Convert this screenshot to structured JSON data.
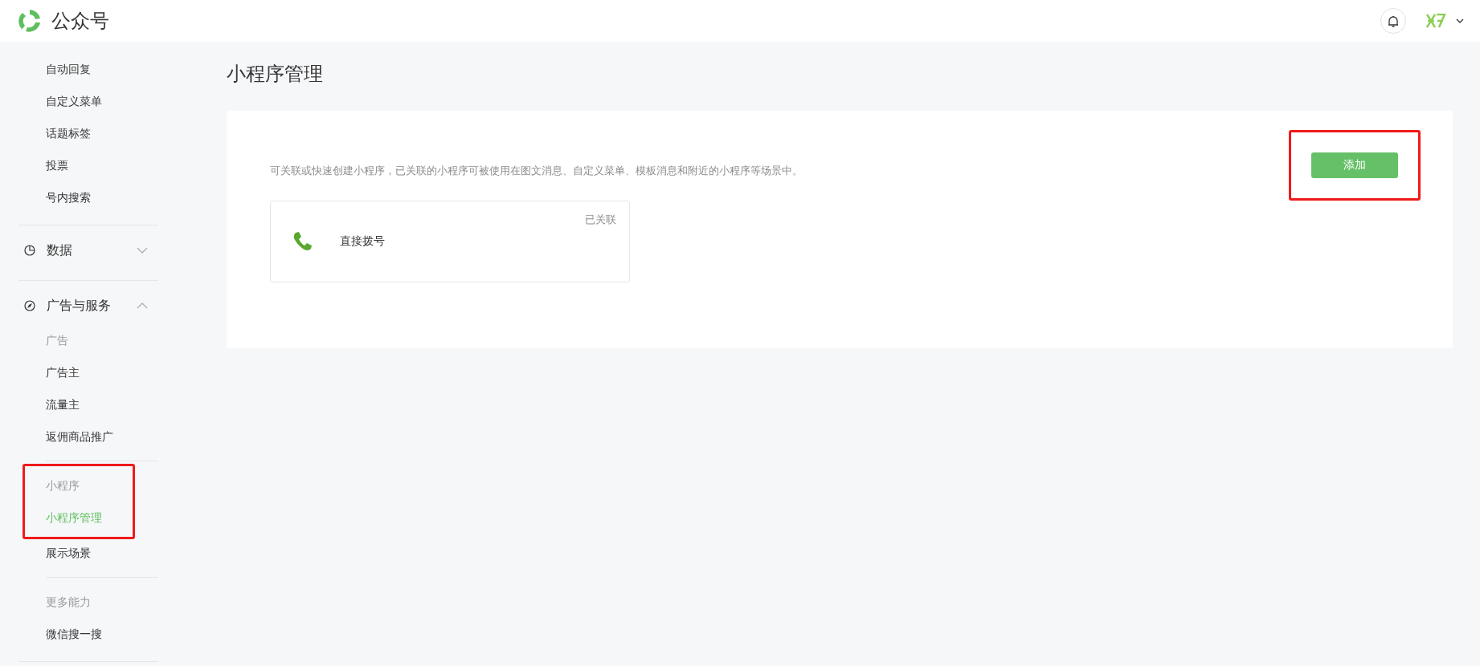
{
  "header": {
    "brand": "公众号"
  },
  "sidebar": [
    {
      "kind": "link",
      "label": "自动回复",
      "selected": false
    },
    {
      "kind": "link",
      "label": "自定义菜单",
      "selected": false
    },
    {
      "kind": "link",
      "label": "话题标签",
      "selected": false
    },
    {
      "kind": "link",
      "label": "投票",
      "selected": false
    },
    {
      "kind": "link",
      "label": "号内搜索",
      "selected": false
    },
    {
      "kind": "divider"
    },
    {
      "kind": "category",
      "label": "数据",
      "expanded": false
    },
    {
      "kind": "divider"
    },
    {
      "kind": "category",
      "label": "广告与服务",
      "expanded": true
    },
    {
      "kind": "heading",
      "label": "广告"
    },
    {
      "kind": "link",
      "label": "广告主",
      "selected": false
    },
    {
      "kind": "link",
      "label": "流量主",
      "selected": false
    },
    {
      "kind": "link",
      "label": "返佣商品推广",
      "selected": false
    },
    {
      "kind": "subdivider"
    },
    {
      "kind": "highlight",
      "items": [
        {
          "kind": "heading",
          "label": "小程序"
        },
        {
          "kind": "link",
          "label": "小程序管理",
          "selected": true
        }
      ]
    },
    {
      "kind": "link",
      "label": "展示场景",
      "selected": false
    },
    {
      "kind": "subdivider"
    },
    {
      "kind": "heading",
      "label": "更多能力"
    },
    {
      "kind": "link",
      "label": "微信搜一搜",
      "selected": false
    },
    {
      "kind": "divider"
    }
  ],
  "main": {
    "title": "小程序管理",
    "description": "可关联或快速创建小程序，已关联的小程序可被使用在图文消息、自定义菜单、模板消息和附近的小程序等场景中。",
    "add_button": {
      "label": "添加",
      "highlighted": true
    },
    "mini_programs": [
      {
        "name": "直接拨号",
        "status": "已关联"
      }
    ]
  }
}
